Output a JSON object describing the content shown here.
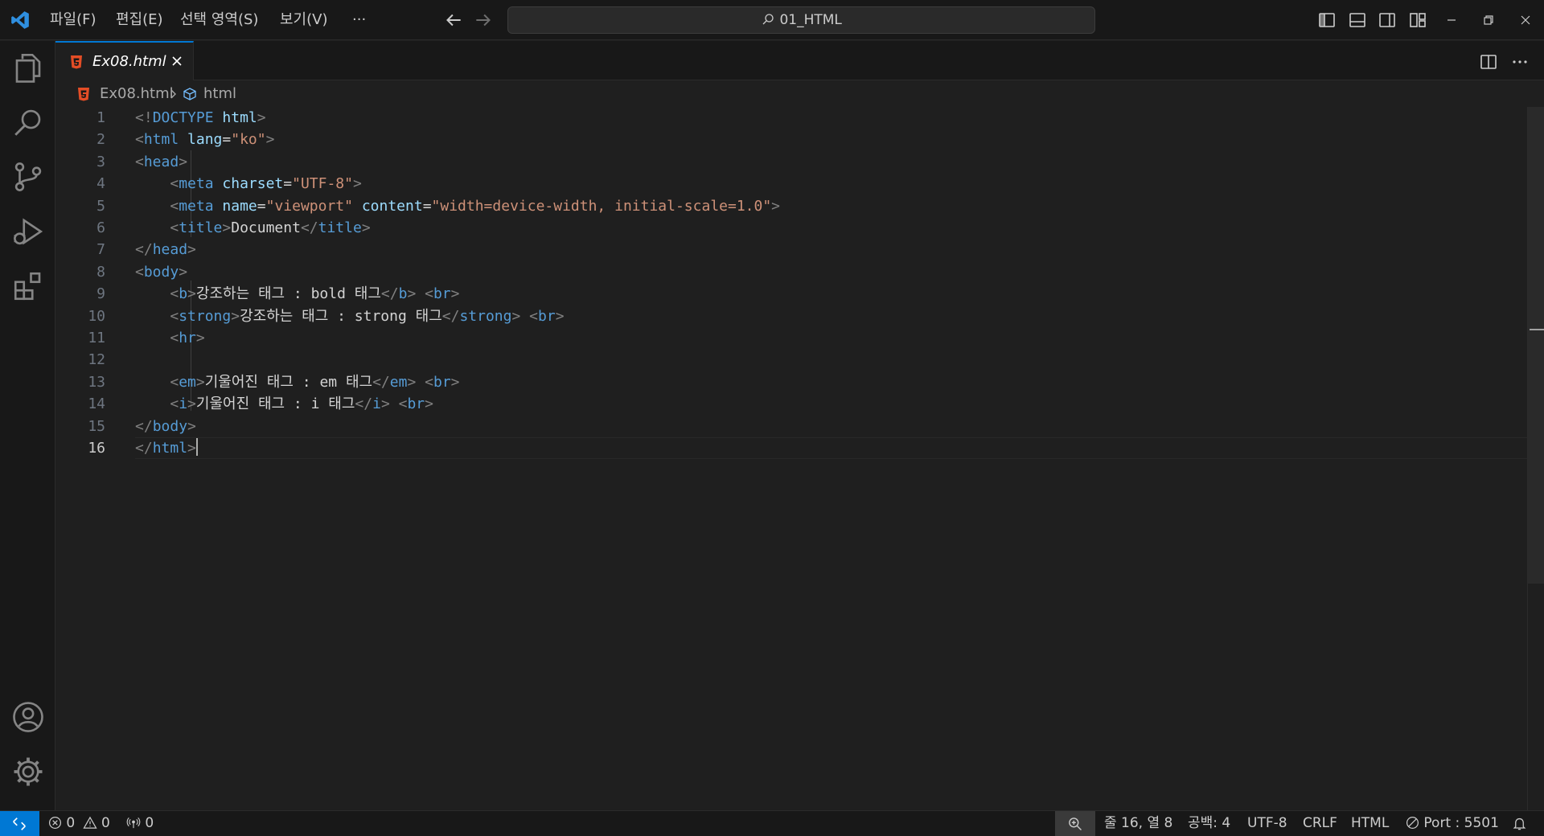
{
  "titlebar": {
    "menus": [
      "파일(F)",
      "편집(E)",
      "선택 영역(S)",
      "보기(V)",
      "···"
    ],
    "search_title": "01_HTML"
  },
  "tab": {
    "label": "Ex08.html"
  },
  "breadcrumb": {
    "file": "Ex08.html",
    "symbol": "html"
  },
  "editor": {
    "current_line": 16,
    "lines": [
      {
        "n": "1",
        "tokens": [
          [
            "p",
            "<!"
          ],
          [
            "g",
            "DOCTYPE"
          ],
          [
            "t",
            " "
          ],
          [
            "a",
            "html"
          ],
          [
            "p",
            ">"
          ]
        ]
      },
      {
        "n": "2",
        "tokens": [
          [
            "p",
            "<"
          ],
          [
            "g",
            "html"
          ],
          [
            "t",
            " "
          ],
          [
            "a",
            "lang"
          ],
          [
            "t",
            "="
          ],
          [
            "s",
            "\"ko\""
          ],
          [
            "p",
            ">"
          ]
        ]
      },
      {
        "n": "3",
        "tokens": [
          [
            "p",
            "<"
          ],
          [
            "g",
            "head"
          ],
          [
            "p",
            ">"
          ]
        ]
      },
      {
        "n": "4",
        "tokens": [
          [
            "t",
            "    "
          ],
          [
            "p",
            "<"
          ],
          [
            "g",
            "meta"
          ],
          [
            "t",
            " "
          ],
          [
            "a",
            "charset"
          ],
          [
            "t",
            "="
          ],
          [
            "s",
            "\"UTF-8\""
          ],
          [
            "p",
            ">"
          ]
        ]
      },
      {
        "n": "5",
        "tokens": [
          [
            "t",
            "    "
          ],
          [
            "p",
            "<"
          ],
          [
            "g",
            "meta"
          ],
          [
            "t",
            " "
          ],
          [
            "a",
            "name"
          ],
          [
            "t",
            "="
          ],
          [
            "s",
            "\"viewport\""
          ],
          [
            "t",
            " "
          ],
          [
            "a",
            "content"
          ],
          [
            "t",
            "="
          ],
          [
            "s",
            "\"width=device-width, initial-scale=1.0\""
          ],
          [
            "p",
            ">"
          ]
        ]
      },
      {
        "n": "6",
        "tokens": [
          [
            "t",
            "    "
          ],
          [
            "p",
            "<"
          ],
          [
            "g",
            "title"
          ],
          [
            "p",
            ">"
          ],
          [
            "t",
            "Document"
          ],
          [
            "p",
            "</"
          ],
          [
            "g",
            "title"
          ],
          [
            "p",
            ">"
          ]
        ]
      },
      {
        "n": "7",
        "tokens": [
          [
            "p",
            "</"
          ],
          [
            "g",
            "head"
          ],
          [
            "p",
            ">"
          ]
        ]
      },
      {
        "n": "8",
        "tokens": [
          [
            "p",
            "<"
          ],
          [
            "g",
            "body"
          ],
          [
            "p",
            ">"
          ]
        ]
      },
      {
        "n": "9",
        "tokens": [
          [
            "t",
            "    "
          ],
          [
            "p",
            "<"
          ],
          [
            "g",
            "b"
          ],
          [
            "p",
            ">"
          ],
          [
            "t",
            "강조하는 태그 : bold 태그"
          ],
          [
            "p",
            "</"
          ],
          [
            "g",
            "b"
          ],
          [
            "p",
            ">"
          ],
          [
            "t",
            " "
          ],
          [
            "p",
            "<"
          ],
          [
            "g",
            "br"
          ],
          [
            "p",
            ">"
          ]
        ]
      },
      {
        "n": "10",
        "tokens": [
          [
            "t",
            "    "
          ],
          [
            "p",
            "<"
          ],
          [
            "g",
            "strong"
          ],
          [
            "p",
            ">"
          ],
          [
            "t",
            "강조하는 태그 : strong 태그"
          ],
          [
            "p",
            "</"
          ],
          [
            "g",
            "strong"
          ],
          [
            "p",
            ">"
          ],
          [
            "t",
            " "
          ],
          [
            "p",
            "<"
          ],
          [
            "g",
            "br"
          ],
          [
            "p",
            ">"
          ]
        ]
      },
      {
        "n": "11",
        "tokens": [
          [
            "t",
            "    "
          ],
          [
            "p",
            "<"
          ],
          [
            "g",
            "hr"
          ],
          [
            "p",
            ">"
          ]
        ]
      },
      {
        "n": "12",
        "tokens": []
      },
      {
        "n": "13",
        "tokens": [
          [
            "t",
            "    "
          ],
          [
            "p",
            "<"
          ],
          [
            "g",
            "em"
          ],
          [
            "p",
            ">"
          ],
          [
            "t",
            "기울어진 태그 : em 태그"
          ],
          [
            "p",
            "</"
          ],
          [
            "g",
            "em"
          ],
          [
            "p",
            ">"
          ],
          [
            "t",
            " "
          ],
          [
            "p",
            "<"
          ],
          [
            "g",
            "br"
          ],
          [
            "p",
            ">"
          ]
        ]
      },
      {
        "n": "14",
        "tokens": [
          [
            "t",
            "    "
          ],
          [
            "p",
            "<"
          ],
          [
            "g",
            "i"
          ],
          [
            "p",
            ">"
          ],
          [
            "t",
            "기울어진 태그 : i 태그"
          ],
          [
            "p",
            "</"
          ],
          [
            "g",
            "i"
          ],
          [
            "p",
            ">"
          ],
          [
            "t",
            " "
          ],
          [
            "p",
            "<"
          ],
          [
            "g",
            "br"
          ],
          [
            "p",
            ">"
          ]
        ]
      },
      {
        "n": "15",
        "tokens": [
          [
            "p",
            "</"
          ],
          [
            "g",
            "body"
          ],
          [
            "p",
            ">"
          ]
        ]
      },
      {
        "n": "16",
        "tokens": [
          [
            "p",
            "</"
          ],
          [
            "g",
            "html"
          ],
          [
            "p",
            ">"
          ]
        ]
      }
    ]
  },
  "statusbar": {
    "errors": "0",
    "warnings": "0",
    "ports": "0",
    "position": "줄 16, 열 8",
    "spaces": "공백: 4",
    "encoding": "UTF-8",
    "eol": "CRLF",
    "language": "HTML",
    "live_server": "Port : 5501"
  },
  "colors": {
    "accent": "#0078d4",
    "background": "#1f1f1f",
    "chrome": "#181818",
    "html_icon": "#e44d26",
    "tag": "#569cd6",
    "attribute": "#9cdcfe",
    "string": "#ce9178"
  },
  "icons": [
    "vscode-logo-icon",
    "arrow-left-icon",
    "arrow-right-icon",
    "search-icon",
    "toggle-primary-sidebar-icon",
    "toggle-panel-icon",
    "toggle-secondary-sidebar-icon",
    "customize-layout-icon",
    "minimize-icon",
    "restore-icon",
    "close-icon",
    "explorer-icon",
    "search-icon",
    "source-control-icon",
    "run-debug-icon",
    "extensions-icon",
    "accounts-icon",
    "manage-gear-icon",
    "html-file-icon",
    "split-editor-icon",
    "more-actions-icon",
    "symbol-html-icon",
    "remote-icon",
    "error-icon",
    "warning-icon",
    "ports-icon",
    "zoom-icon",
    "live-server-icon",
    "bell-icon"
  ]
}
